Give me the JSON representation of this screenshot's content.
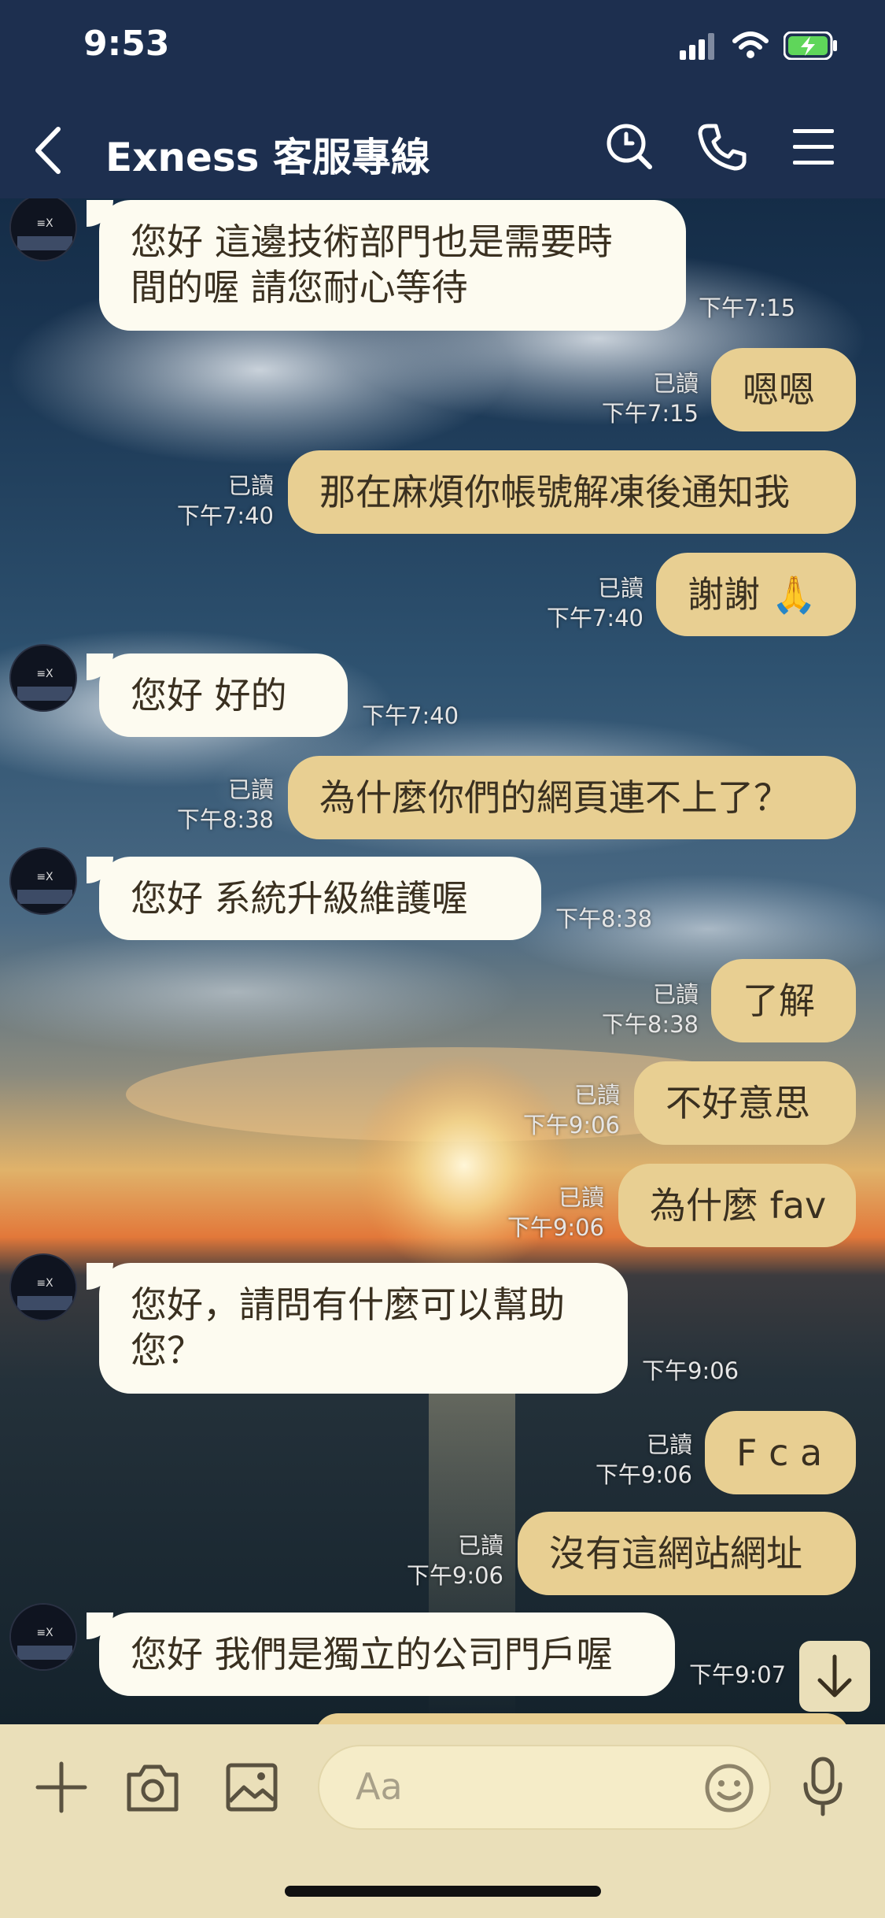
{
  "status_bar": {
    "time": "9:53"
  },
  "header": {
    "title": "Exness 客服專線",
    "back": "back-icon",
    "actions": [
      "search-icon",
      "phone-icon",
      "menu-icon"
    ]
  },
  "messages": [
    {
      "side": "in",
      "lines": [
        "您好  這邊技術部門也是需要時",
        "間的喔   請您耐心等待"
      ],
      "time": "下午7:15"
    },
    {
      "side": "out",
      "lines": [
        "嗯嗯"
      ],
      "read": "已讀",
      "time": "下午7:15"
    },
    {
      "side": "out",
      "lines": [
        "那在麻煩你帳號解凍後通知我"
      ],
      "read": "已讀",
      "time": "下午7:40"
    },
    {
      "side": "out",
      "lines": [
        "謝謝 🙏"
      ],
      "read": "已讀",
      "time": "下午7:40"
    },
    {
      "side": "in",
      "lines": [
        "您好    好的"
      ],
      "time": "下午7:40"
    },
    {
      "side": "out",
      "lines": [
        "為什麼你們的網頁連不上了？"
      ],
      "read": "已讀",
      "time": "下午8:38"
    },
    {
      "side": "in",
      "lines": [
        "您好    系統升級維護喔"
      ],
      "time": "下午8:38"
    },
    {
      "side": "out",
      "lines": [
        "了解"
      ],
      "read": "已讀",
      "time": "下午8:38"
    },
    {
      "side": "out",
      "lines": [
        "不好意思"
      ],
      "read": "已讀",
      "time": "下午9:06"
    },
    {
      "side": "out",
      "lines": [
        "為什麼 fav"
      ],
      "read": "已讀",
      "time": "下午9:06"
    },
    {
      "side": "in",
      "lines": [
        "您好，請問有什麼可以幫助",
        "您？"
      ],
      "time": "下午9:06"
    },
    {
      "side": "out",
      "lines": [
        "F c a"
      ],
      "read": "已讀",
      "time": "下午9:06"
    },
    {
      "side": "out",
      "lines": [
        "沒有這網站網址"
      ],
      "read": "已讀",
      "time": "下午9:06"
    },
    {
      "side": "in",
      "lines": [
        "您好 我們是獨立的公司門戶喔"
      ],
      "time": "下午9:07"
    }
  ],
  "input": {
    "placeholder": "Aa"
  },
  "bottom_icons": [
    "plus-icon",
    "camera-icon",
    "image-icon",
    "emoji-icon",
    "mic-icon"
  ],
  "colors": {
    "header": "#1d2f4f",
    "incoming": "#fdfbf0",
    "outgoing": "#e8cf92",
    "bottom": "#eadfb9"
  }
}
